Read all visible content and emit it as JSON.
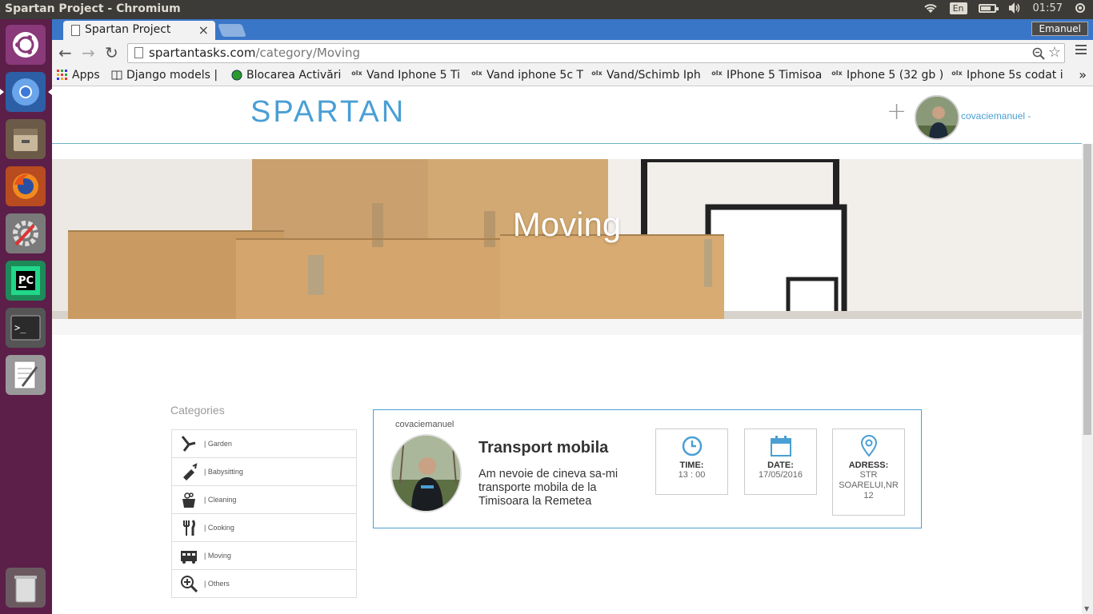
{
  "os": {
    "window_title": "Spartan Project - Chromium",
    "lang": "En",
    "clock": "01:57"
  },
  "launcher": {
    "items": [
      "ubuntu-dash",
      "chromium",
      "files",
      "firefox",
      "system-settings",
      "pycharm",
      "terminal",
      "text-editor",
      "trash"
    ]
  },
  "browser": {
    "tab_title": "Spartan Project",
    "tab_close": "×",
    "profile_name": "Emanuel",
    "url_host": "spartantasks.com",
    "url_path": "/category/Moving",
    "bookmarks": [
      {
        "label": "Apps",
        "icon": "apps-grid-icon"
      },
      {
        "label": "Django models | ",
        "icon": "book-icon"
      },
      {
        "label": "Blocarea Activări",
        "icon": "green-dot-icon"
      },
      {
        "label": "Vand Iphone 5 Ti",
        "icon": "olx-icon"
      },
      {
        "label": "Vand iphone 5c T",
        "icon": "olx-icon"
      },
      {
        "label": "Vand/Schimb Iph",
        "icon": "olx-icon"
      },
      {
        "label": "IPhone 5 Timisoa",
        "icon": "olx-icon"
      },
      {
        "label": "Iphone 5 (32 gb )",
        "icon": "olx-icon"
      },
      {
        "label": "Iphone 5s codat i",
        "icon": "olx-icon"
      }
    ],
    "bookmarks_more": "»"
  },
  "site": {
    "logo": "SPARTAN",
    "add_label": "+",
    "username": "covaciemanuel -",
    "hero_title": "Moving",
    "categories_heading": "Categories",
    "categories": [
      {
        "label": "| Garden",
        "icon": "garden-shears-icon"
      },
      {
        "label": "| Babysitting",
        "icon": "baby-bottle-icon"
      },
      {
        "label": "| Cleaning",
        "icon": "cleaning-bucket-icon"
      },
      {
        "label": "| Cooking",
        "icon": "fork-knife-icon"
      },
      {
        "label": "| Moving",
        "icon": "moving-truck-icon"
      },
      {
        "label": "| Others",
        "icon": "zoom-plus-icon"
      }
    ],
    "task": {
      "user": "covaciemanuel",
      "title": "Transport mobila",
      "description": "Am nevoie de cineva sa-mi transporte mobila de la Timisoara la Remetea",
      "time_label": "TIME:",
      "time_value": "13 : 00",
      "date_label": "DATE:",
      "date_value": "17/05/2016",
      "address_label": "ADRESS:",
      "address_value": "STR SOARELUI,NR 12"
    }
  },
  "colors": {
    "accent": "#4a9fd4",
    "launcher_bg": "#5b1f49",
    "tabbar": "#3a76c8"
  }
}
